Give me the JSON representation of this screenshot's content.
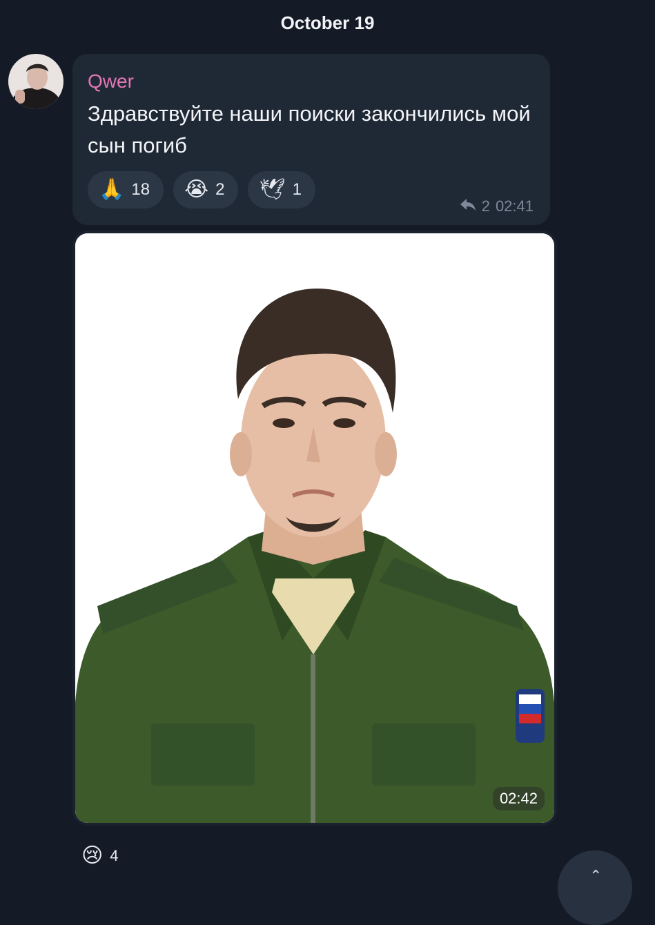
{
  "date_chip": "October 19",
  "message": {
    "sender": "Qwer",
    "text": "Здравствуйте наши поиски закончились мой сын погиб",
    "reactions": [
      {
        "emoji": "🙏",
        "count": "18"
      },
      {
        "emoji": "😭",
        "count": "2"
      },
      {
        "emoji": "🕊",
        "count": "1"
      }
    ],
    "replies": "2",
    "time": "02:41"
  },
  "photo_message": {
    "time": "02:42",
    "reaction": {
      "emoji": "😢",
      "count": "4"
    }
  },
  "colors": {
    "background": "#151b26",
    "bubble": "#1f2835",
    "sender": "#e477b4",
    "meta": "#7e8a9a"
  },
  "icons": [
    "reply-icon",
    "scroll-down-icon"
  ]
}
